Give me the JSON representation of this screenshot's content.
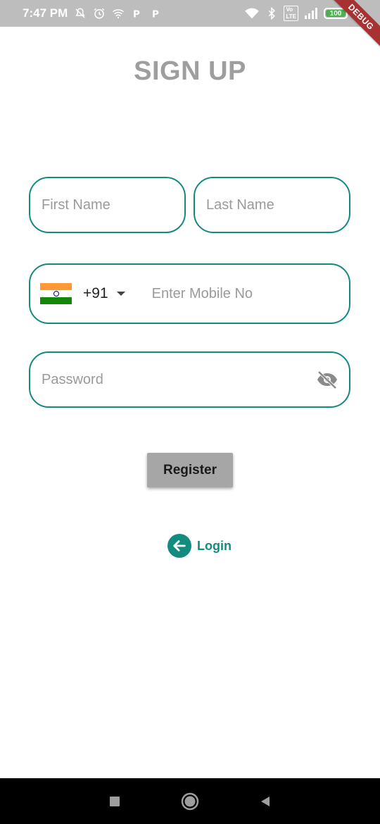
{
  "status_bar": {
    "time": "7:47 PM",
    "battery_level": "100",
    "colors": {
      "background": "#bdbdbd",
      "battery_fill": "#4caf50"
    },
    "icons": [
      "mute-icon",
      "alarm-icon",
      "wifi-icon",
      "p-icon",
      "p-icon",
      "wifi-icon",
      "bluetooth-icon",
      "volte-icon",
      "signal-icon",
      "battery-icon",
      "charging-icon"
    ]
  },
  "debug_banner": {
    "label": "DEBUG"
  },
  "page": {
    "title": "SIGN UP",
    "title_color": "#9e9e9e",
    "accent_color": "#138a80"
  },
  "form": {
    "first_name": {
      "placeholder": "First Name",
      "value": ""
    },
    "last_name": {
      "placeholder": "Last Name",
      "value": ""
    },
    "phone": {
      "country_flag": "india-flag",
      "dial_code": "+91",
      "placeholder": "Enter Mobile No",
      "value": ""
    },
    "password": {
      "placeholder": "Password",
      "value": "",
      "toggle_icon": "eye-off-icon"
    },
    "register_label": "Register"
  },
  "login_link": {
    "label": "Login",
    "icon": "arrow-left-circle-icon",
    "color": "#128c7e"
  },
  "nav_bar": {
    "icons": [
      "recent-apps-icon",
      "home-icon",
      "back-icon"
    ]
  }
}
